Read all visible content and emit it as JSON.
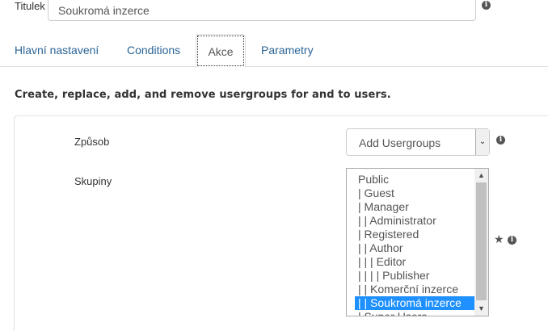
{
  "title_field": {
    "label": "Titulek",
    "value": "Soukromá inzerce"
  },
  "tabs": [
    {
      "label": "Hlavní nastavení"
    },
    {
      "label": "Conditions"
    },
    {
      "label": "Akce",
      "active": true
    },
    {
      "label": "Parametry"
    }
  ],
  "description": "Create, replace, add, and remove usergroups for and to users.",
  "method": {
    "label": "Způsob",
    "selected": "Add Usergroups"
  },
  "groups": {
    "label": "Skupiny",
    "options": [
      "Public",
      "| Guest",
      "| Manager",
      "| | Administrator",
      "| Registered",
      "| | Author",
      "| | | Editor",
      "| | | | Publisher",
      "| | Komerční inzerce",
      "| | Soukromá inzerce",
      "| Super Users"
    ],
    "selected_index": 9
  },
  "icons": {
    "info": "info-icon",
    "star": "star-icon",
    "dropdown": "chevron-down-icon",
    "scroll_up": "scroll-up-arrow",
    "scroll_down": "scroll-down-arrow"
  },
  "colors": {
    "link": "#2a6496",
    "selected_bg": "#1e90ff",
    "border": "#cccccc"
  }
}
